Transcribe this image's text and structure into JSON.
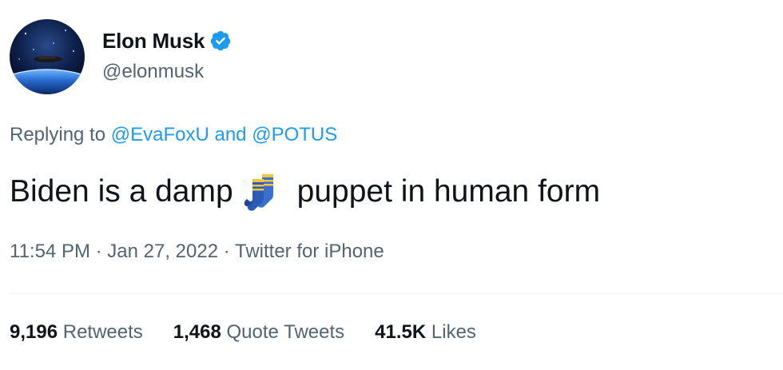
{
  "author": {
    "display_name": "Elon Musk",
    "handle": "@elonmusk",
    "verified": true
  },
  "reply_context": {
    "prefix": "Replying to ",
    "mention_1": "@EvaFoxU",
    "conjunction": " and ",
    "mention_2": "@POTUS"
  },
  "tweet": {
    "text_before_emoji": "Biden is a damp",
    "emoji": "socks-emoji",
    "text_after_emoji": "puppet in human form"
  },
  "meta": {
    "time": "11:54 PM",
    "sep1": " · ",
    "date": "Jan 27, 2022",
    "sep2": " · ",
    "source": "Twitter for iPhone"
  },
  "stats": {
    "retweets_count": "9,196",
    "retweets_label": "Retweets",
    "quotes_count": "1,468",
    "quotes_label": "Quote Tweets",
    "likes_count": "41.5K",
    "likes_label": "Likes"
  },
  "colors": {
    "text": "#0f1419",
    "secondary": "#536471",
    "accent": "#1d9bf0"
  }
}
